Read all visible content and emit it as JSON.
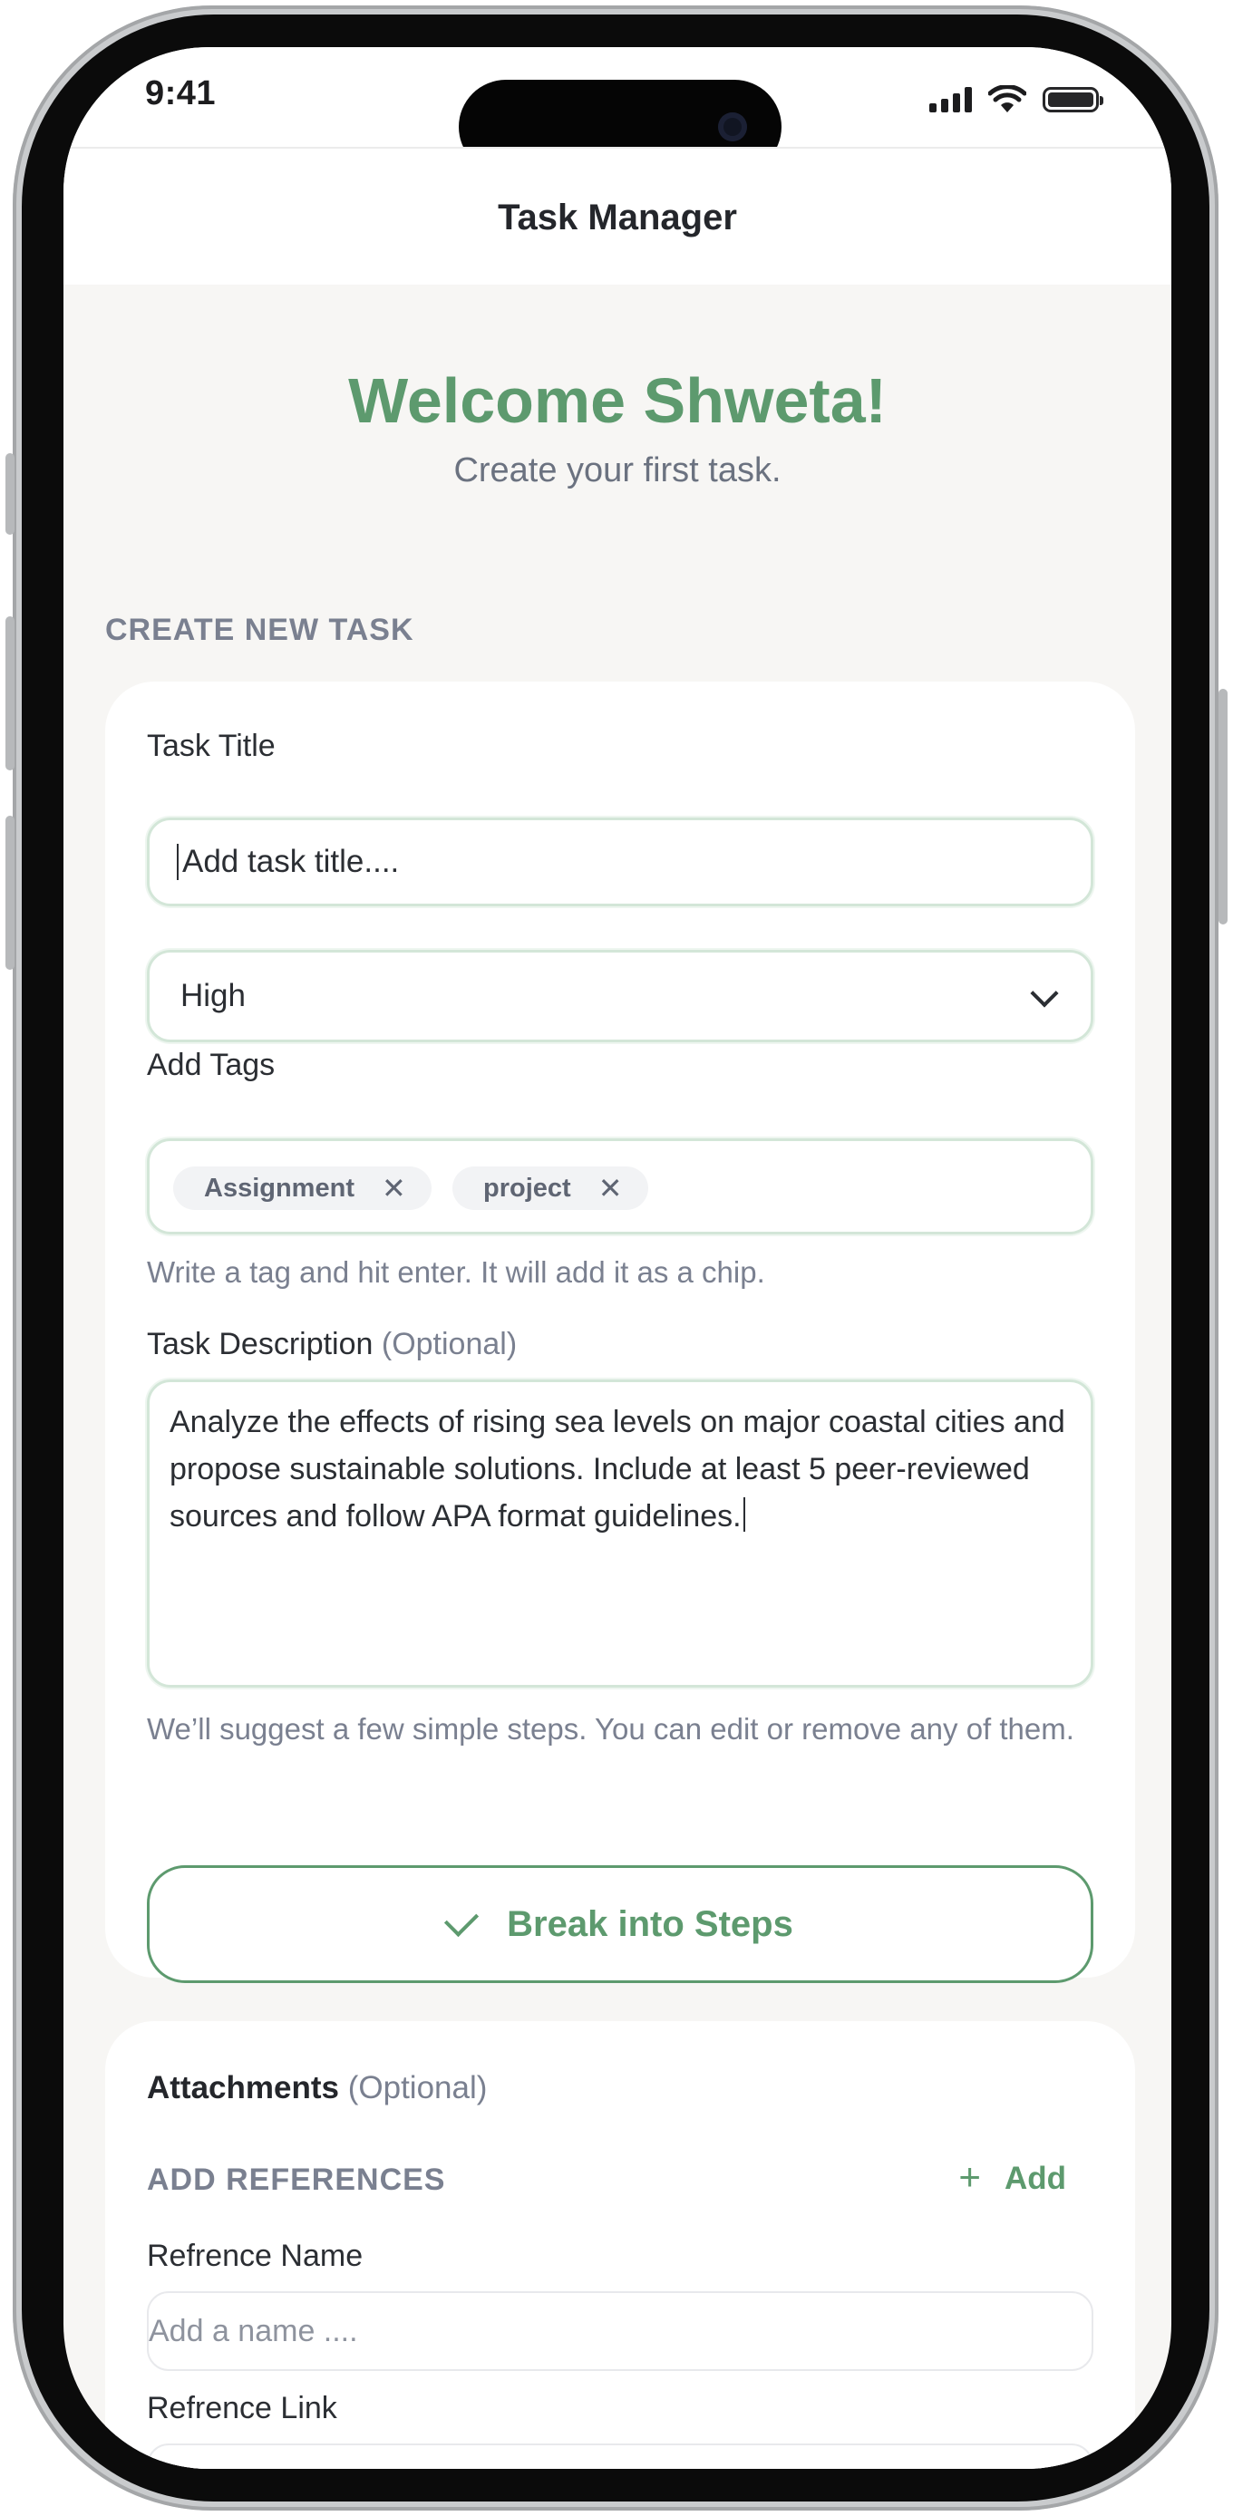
{
  "status_bar": {
    "time": "9:41"
  },
  "nav": {
    "title": "Task Manager"
  },
  "welcome": {
    "title": "Welcome Shweta!",
    "subtitle": "Create your first task."
  },
  "create_task": {
    "section_label": "CREATE NEW TASK",
    "title_label": "Task Title",
    "title_placeholder": "Add task title....",
    "priority_value": "High",
    "tags_label": "Add Tags",
    "tags": [
      "Assignment",
      "project"
    ],
    "tags_helper": "Write a tag and hit enter. It will add it as a chip.",
    "description_label": "Task Description",
    "description_optional": "(Optional)",
    "description_value": "Analyze the effects of rising sea levels on major coastal cities and propose sustainable solutions. Include at least 5 peer-reviewed sources and follow APA format guidelines.",
    "steps_helper": "We’ll suggest a few simple steps. You can edit or remove any of them.",
    "break_button": "Break into Steps"
  },
  "attachments": {
    "title": "Attachments",
    "optional": "(Optional)",
    "add_references_label": "ADD REFERENCES",
    "add_button": "Add",
    "ref_name_label": "Refrence Name",
    "ref_name_placeholder": "Add a name ....",
    "ref_link_label": "Refrence Link"
  },
  "colors": {
    "accent": "#5d9a6e",
    "muted_text": "#7a8090",
    "screen_bg": "#f7f6f4"
  },
  "icons": {
    "signal": "cellular-signal-icon",
    "wifi": "wifi-icon",
    "battery": "battery-icon",
    "chevron": "chevron-down-icon",
    "chip_remove": "close-icon",
    "check": "check-icon",
    "plus": "plus-icon"
  }
}
